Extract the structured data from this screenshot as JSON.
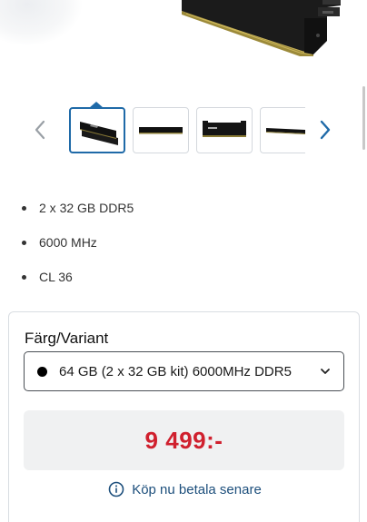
{
  "hero": {
    "image": "memory-module-product-photo"
  },
  "carousel": {
    "prev_icon": "chevron-left-icon",
    "next_icon": "chevron-right-icon",
    "thumbnails": [
      {
        "image": "ram-kit-pair-photo",
        "selected": true
      },
      {
        "image": "ram-module-side-photo",
        "selected": false
      },
      {
        "image": "ram-module-front-photo",
        "selected": false
      },
      {
        "image": "ram-module-angle-photo",
        "selected": false
      }
    ]
  },
  "specs": [
    "2 x 32 GB DDR5",
    "6000 MHz",
    "CL 36"
  ],
  "variant": {
    "label": "Färg/Variant",
    "selected": "64 GB (2 x 32 GB kit) 6000MHz DDR5",
    "swatch_color": "#000000"
  },
  "price": {
    "value": "9 499:-",
    "color": "#d0202e"
  },
  "paylater": {
    "icon": "info-icon",
    "label": "Köp nu betala senare",
    "color": "#1d4f7c"
  },
  "colors": {
    "accent": "#1f6aa8"
  }
}
